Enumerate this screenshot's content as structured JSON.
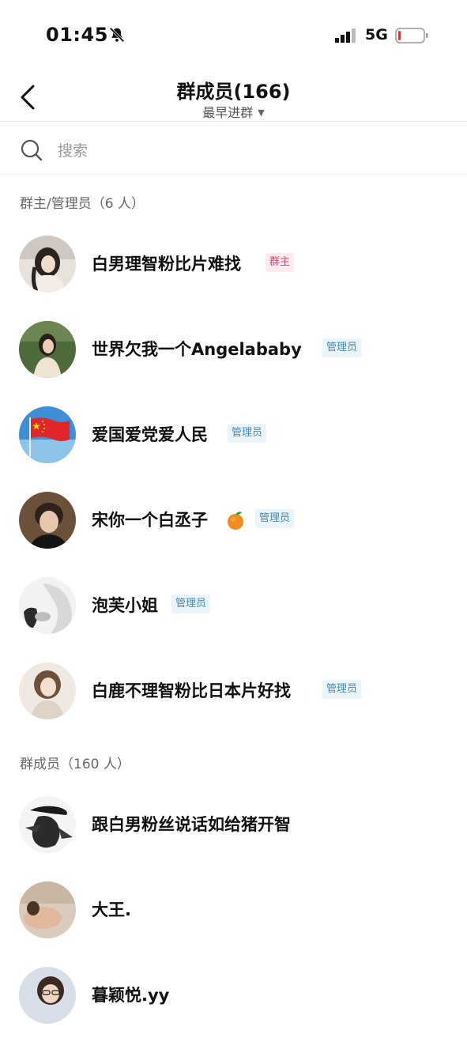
{
  "status_bar": {
    "time": "01:45",
    "network": "5G"
  },
  "nav": {
    "title": "群成员(166)",
    "sort_label": "最早进群"
  },
  "search": {
    "placeholder": "搜索"
  },
  "sections": [
    {
      "title": "群主/管理员（6 人）"
    },
    {
      "title": "群成员（160 人）"
    }
  ],
  "admins": [
    {
      "name": "白男理智粉比片难找",
      "badge": "群主",
      "badge_type": "owner"
    },
    {
      "name": "世界欠我一个Angelababy",
      "badge": "管理员",
      "badge_type": "admin"
    },
    {
      "name": "爱国爱党爱人民",
      "badge": "管理员",
      "badge_type": "admin"
    },
    {
      "name": "宋你一个白丞子",
      "badge": "管理员",
      "badge_type": "admin",
      "emoji": "tangerine-icon"
    },
    {
      "name": "泡芙小姐",
      "badge": "管理员",
      "badge_type": "admin"
    },
    {
      "name": "白鹿不理智粉比日本片好找",
      "badge": "管理员",
      "badge_type": "admin"
    }
  ],
  "members": [
    {
      "name": "跟白男粉丝说话如给猪开智"
    },
    {
      "name": "大王."
    },
    {
      "name": "暮颖悦.yy"
    }
  ],
  "colors": {
    "admin_badge": "#3a8ec3",
    "owner_badge": "#d9466e"
  }
}
